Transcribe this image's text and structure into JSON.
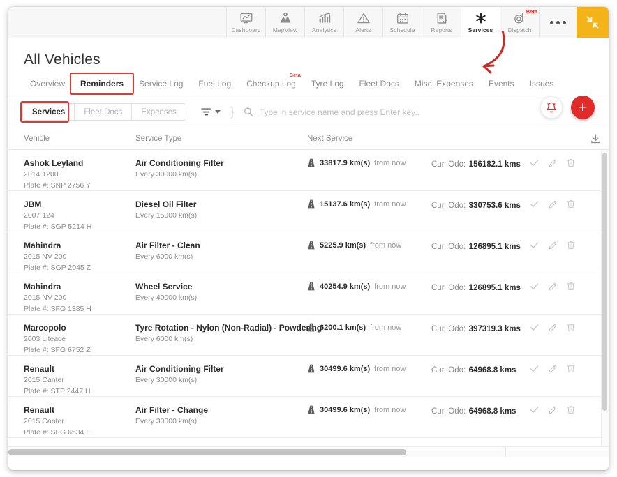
{
  "topnav": {
    "items": [
      {
        "label": "Dashboard",
        "icon": "dashboard-icon",
        "active": false,
        "beta": null
      },
      {
        "label": "MapView",
        "icon": "mapview-icon",
        "active": false,
        "beta": null
      },
      {
        "label": "Analytics",
        "icon": "analytics-icon",
        "active": false,
        "beta": null
      },
      {
        "label": "Alerts",
        "icon": "alerts-icon",
        "active": false,
        "beta": null
      },
      {
        "label": "Schedule",
        "icon": "schedule-icon",
        "active": false,
        "beta": null
      },
      {
        "label": "Reports",
        "icon": "reports-icon",
        "active": false,
        "beta": null
      },
      {
        "label": "Services",
        "icon": "services-icon",
        "active": true,
        "beta": null
      },
      {
        "label": "Dispatch",
        "icon": "dispatch-icon",
        "active": false,
        "beta": "Beta"
      }
    ],
    "more_label": "more-options",
    "expand_label": "expand-icon",
    "expand_bg": "#f5b31a"
  },
  "page": {
    "title": "All Vehicles"
  },
  "tabs": [
    {
      "label": "Overview",
      "active": false,
      "beta": null,
      "highlight": false
    },
    {
      "label": "Reminders",
      "active": true,
      "beta": null,
      "highlight": true
    },
    {
      "label": "Service Log",
      "active": false,
      "beta": null,
      "highlight": false
    },
    {
      "label": "Fuel Log",
      "active": false,
      "beta": null,
      "highlight": false
    },
    {
      "label": "Checkup Log",
      "active": false,
      "beta": "Beta",
      "highlight": false
    },
    {
      "label": "Tyre Log",
      "active": false,
      "beta": null,
      "highlight": false
    },
    {
      "label": "Fleet Docs",
      "active": false,
      "beta": null,
      "highlight": false
    },
    {
      "label": "Misc. Expenses",
      "active": false,
      "beta": null,
      "highlight": false
    },
    {
      "label": "Events",
      "active": false,
      "beta": null,
      "highlight": false
    },
    {
      "label": "Issues",
      "active": false,
      "beta": null,
      "highlight": false
    }
  ],
  "toolbar": {
    "segments": [
      {
        "label": "Services",
        "active": true,
        "highlight": true
      },
      {
        "label": "Fleet Docs",
        "active": false,
        "highlight": false
      },
      {
        "label": "Expenses",
        "active": false,
        "highlight": false
      }
    ],
    "filter_icon": "filter-icon",
    "search_icon": "search-icon",
    "search_placeholder": "Type in service name and press Enter key..",
    "search_value": ""
  },
  "fabs": {
    "bell_label": "notifications-bell",
    "add_label": "+",
    "accent_red": "#e02b28"
  },
  "table": {
    "headers": {
      "vehicle": "Vehicle",
      "service_type": "Service Type",
      "next_service": "Next Service",
      "download_icon": "download-icon"
    },
    "rows": [
      {
        "vehicle": "Ashok Leyland",
        "vehicle_model": "2014 1200",
        "plate": "Plate #: SNP 2756 Y",
        "service_type": "Air Conditioning Filter",
        "interval": "Every 30000 km(s)",
        "next_km": "33817.9 km(s)",
        "next_suffix": "from now",
        "odo_label": "Cur. Odo:",
        "odo_value": "156182.1 kms"
      },
      {
        "vehicle": "JBM",
        "vehicle_model": "2007 124",
        "plate": "Plate #: SGP 5214 H",
        "service_type": "Diesel Oil Filter",
        "interval": "Every 15000 km(s)",
        "next_km": "15137.6 km(s)",
        "next_suffix": "from now",
        "odo_label": "Cur. Odo:",
        "odo_value": "330753.6 kms"
      },
      {
        "vehicle": "Mahindra",
        "vehicle_model": "2015 NV 200",
        "plate": "Plate #: SGP 2045 Z",
        "service_type": "Air Filter - Clean",
        "interval": "Every 6000 km(s)",
        "next_km": "5225.9 km(s)",
        "next_suffix": "from now",
        "odo_label": "Cur. Odo:",
        "odo_value": "126895.1 kms"
      },
      {
        "vehicle": "Mahindra",
        "vehicle_model": "2015 NV 200",
        "plate": "Plate #: SFG 1385 H",
        "service_type": "Wheel Service",
        "interval": "Every 40000 km(s)",
        "next_km": "40254.9 km(s)",
        "next_suffix": "from now",
        "odo_label": "Cur. Odo:",
        "odo_value": "126895.1 kms"
      },
      {
        "vehicle": "Marcopolo",
        "vehicle_model": "2003 Liteace",
        "plate": "Plate #: SFG 6752 Z",
        "service_type": "Tyre Rotation - Nylon (Non-Radial) - Powdering",
        "interval": "Every 6000 km(s)",
        "next_km": "6200.1 km(s)",
        "next_suffix": "from now",
        "odo_label": "Cur. Odo:",
        "odo_value": "397319.3 kms"
      },
      {
        "vehicle": "Renault",
        "vehicle_model": "2015 Canter",
        "plate": "Plate #: STP 2447 H",
        "service_type": "Air Conditioning Filter",
        "interval": "Every 30000 km(s)",
        "next_km": "30499.6 km(s)",
        "next_suffix": "from now",
        "odo_label": "Cur. Odo:",
        "odo_value": "64968.8 kms"
      },
      {
        "vehicle": "Renault",
        "vehicle_model": "2015 Canter",
        "plate": "Plate #: SFG 6534 E",
        "service_type": "Air Filter - Change",
        "interval": "Every 30000 km(s)",
        "next_km": "30499.6 km(s)",
        "next_suffix": "from now",
        "odo_label": "Cur. Odo:",
        "odo_value": "64968.8 kms"
      }
    ],
    "row_actions": [
      {
        "icon": "check-icon"
      },
      {
        "icon": "edit-pencil-icon"
      },
      {
        "icon": "delete-trash-icon"
      }
    ]
  },
  "annotations": {
    "arrow_color": "#cc2a22",
    "box_color": "#e03a2f"
  }
}
